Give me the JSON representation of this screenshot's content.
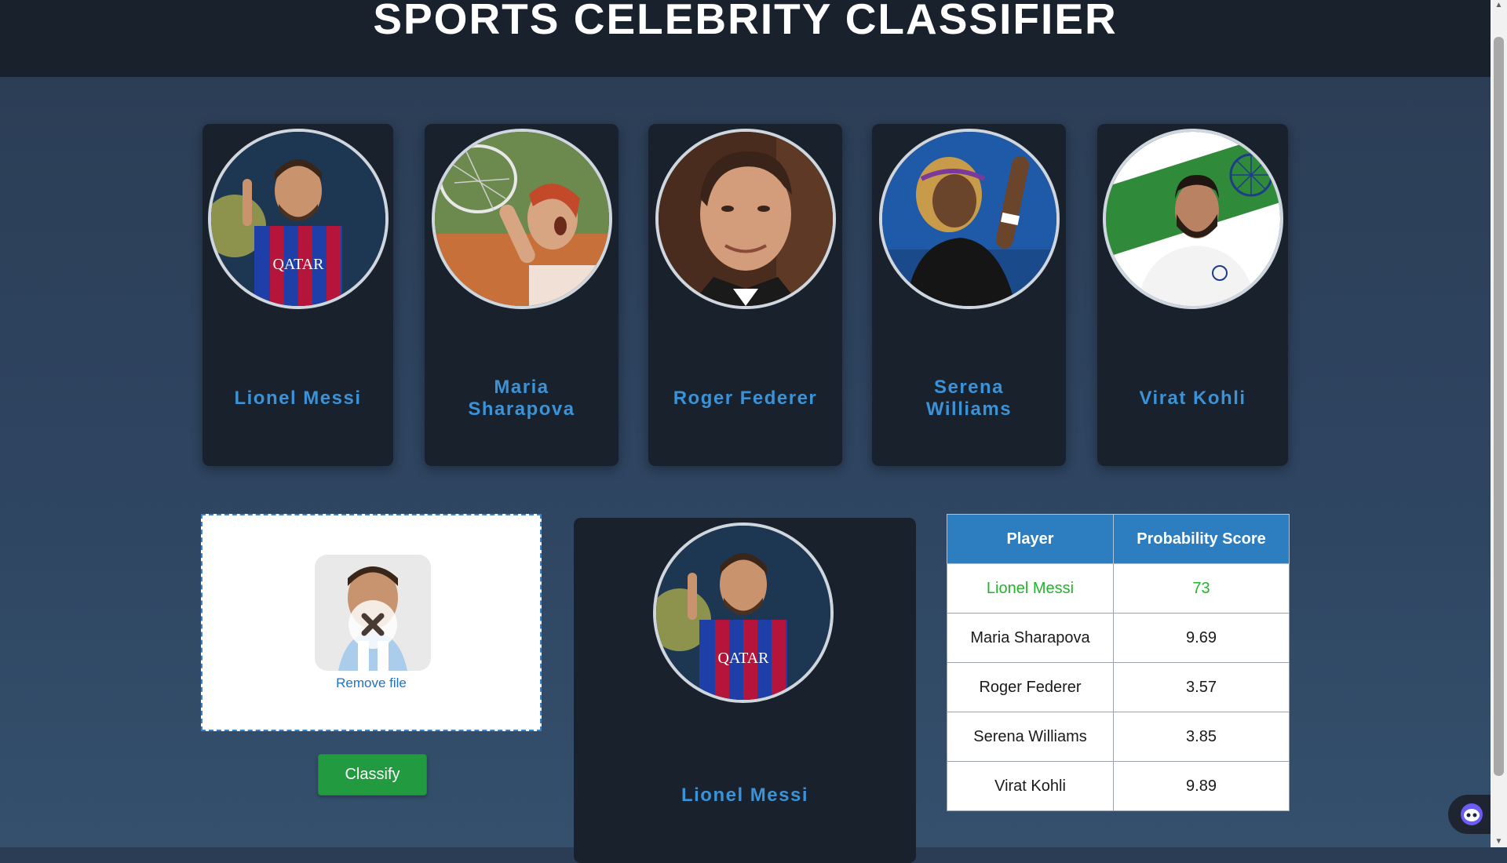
{
  "header": {
    "title": "SPORTS CELEBRITY CLASSIFIER"
  },
  "celebrities": [
    {
      "name": "Lionel Messi",
      "jersey": [
        "#1e3fa8",
        "#b5153b"
      ]
    },
    {
      "name": "Maria Sharapova"
    },
    {
      "name": "Roger Federer"
    },
    {
      "name": "Serena Williams"
    },
    {
      "name": "Virat Kohli"
    }
  ],
  "upload": {
    "remove_label": "Remove file"
  },
  "classify_button": "Classify",
  "result": {
    "name": "Lionel Messi"
  },
  "table": {
    "headers": [
      "Player",
      "Probability Score"
    ],
    "rows": [
      {
        "player": "Lionel Messi",
        "score": "73"
      },
      {
        "player": "Maria Sharapova",
        "score": "9.69"
      },
      {
        "player": "Roger Federer",
        "score": "3.57"
      },
      {
        "player": "Serena Williams",
        "score": "3.85"
      },
      {
        "player": "Virat Kohli",
        "score": "9.89"
      }
    ]
  },
  "colors": {
    "header_bg": "#18212c",
    "card_bg": "#18212c",
    "name_blue": "#3b92d6",
    "table_head": "#2c7ec0",
    "top_score_green": "#22b52c",
    "classify_green": "#229a3f"
  },
  "icons": {
    "remove": "close-icon",
    "assistant": "assistant-icon"
  }
}
